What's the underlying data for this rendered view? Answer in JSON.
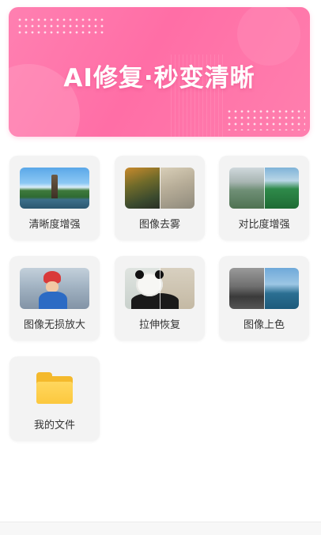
{
  "banner": {
    "title": "AI修复·秒变清晰"
  },
  "features": [
    {
      "label": "清晰度增强",
      "icon": "clarity-enhance-thumbnail"
    },
    {
      "label": "图像去雾",
      "icon": "image-defog-thumbnail"
    },
    {
      "label": "对比度增强",
      "icon": "contrast-enhance-thumbnail"
    },
    {
      "label": "图像无损放大",
      "icon": "lossless-upscale-thumbnail"
    },
    {
      "label": "拉伸恢复",
      "icon": "stretch-restore-thumbnail"
    },
    {
      "label": "图像上色",
      "icon": "image-colorize-thumbnail"
    },
    {
      "label": "我的文件",
      "icon": "folder-icon"
    }
  ],
  "colors": {
    "banner_pink": "#ff6ea6",
    "card_bg": "#f3f3f3",
    "label_text": "#333333",
    "folder_yellow": "#fcc83e"
  }
}
